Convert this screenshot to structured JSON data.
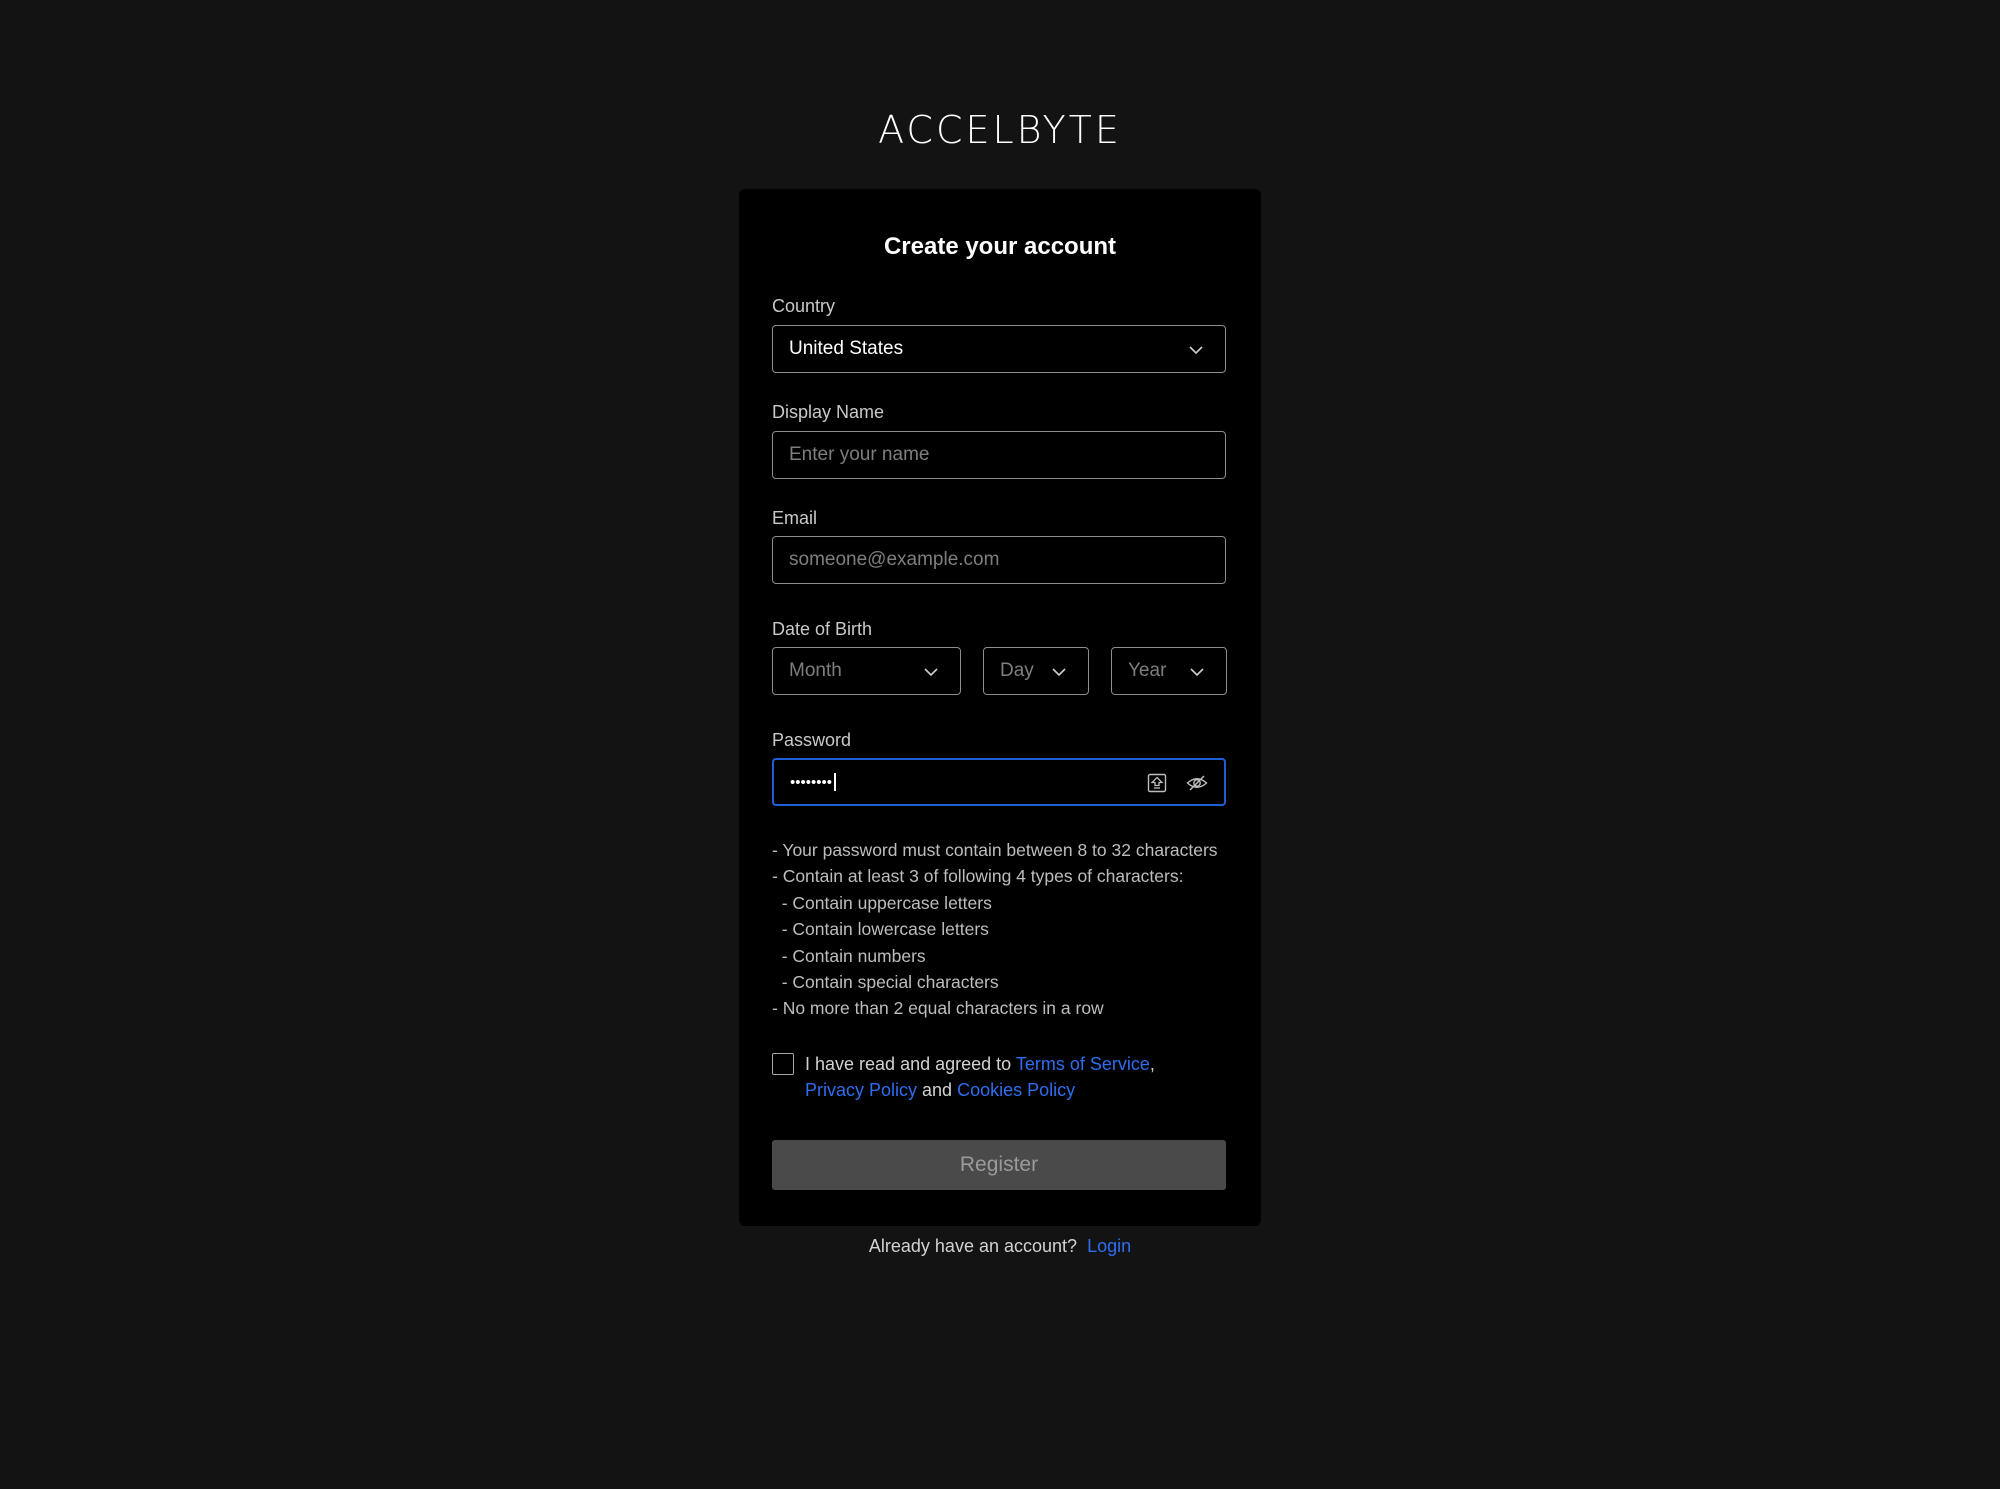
{
  "logo": {
    "part1": "ACCEL",
    "part2": "BYTE"
  },
  "form": {
    "title": "Create your account",
    "country": {
      "label": "Country",
      "value": "United States"
    },
    "display_name": {
      "label": "Display Name",
      "placeholder": "Enter your name"
    },
    "email": {
      "label": "Email",
      "placeholder": "someone@example.com"
    },
    "dob": {
      "label": "Date of Birth",
      "month": "Month",
      "day": "Day",
      "year": "Year"
    },
    "password": {
      "label": "Password",
      "value": "••••••••"
    },
    "rules": [
      "- Your password must contain between 8 to 32 characters",
      "- Contain at least 3 of following 4 types of characters:",
      "  - Contain uppercase letters",
      "  - Contain lowercase letters",
      "  - Contain numbers",
      "  - Contain special characters",
      "- No more than 2 equal characters in a row"
    ],
    "agree": {
      "prefix": "I have read and agreed to ",
      "terms": "Terms of Service",
      "comma": ",",
      "privacy": "Privacy Policy",
      "and": " and ",
      "cookies": "Cookies Policy"
    },
    "register_label": "Register"
  },
  "footer": {
    "text": "Already have an account?",
    "login": "Login"
  },
  "colors": {
    "background": "#131313",
    "card": "#000000",
    "link": "#2f6df0",
    "focus_border": "#1f5fd6",
    "button_disabled": "#4a4a4a"
  },
  "icons": [
    "chevron-down-icon",
    "caps-lock-icon",
    "eye-slash-icon"
  ]
}
